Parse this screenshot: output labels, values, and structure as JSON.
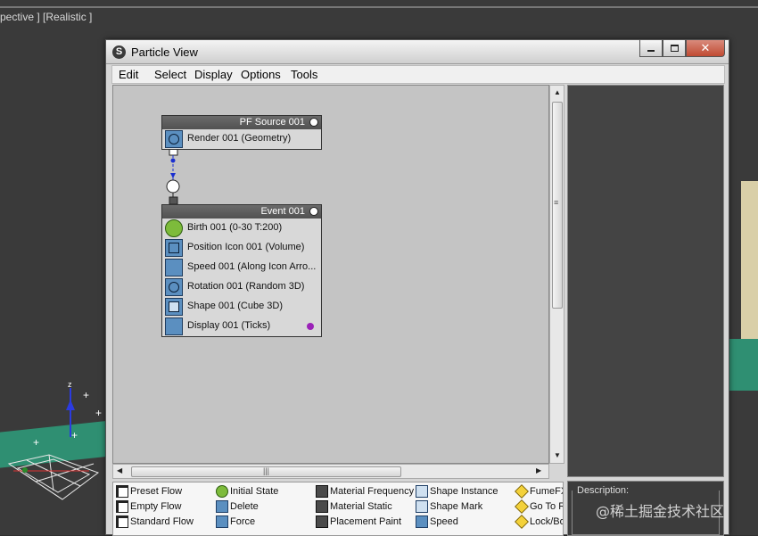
{
  "viewport": {
    "label": "pective ] [Realistic ]"
  },
  "window": {
    "title": "Particle View",
    "logo": "S",
    "close_glyph": "✕"
  },
  "menu": [
    "Edit",
    "Select",
    "Display",
    "Options",
    "Tools"
  ],
  "nodes": {
    "source": {
      "title": "PF Source 001",
      "operators": [
        "Render 001 (Geometry)"
      ]
    },
    "event": {
      "title": "Event 001",
      "operators": [
        "Birth 001 (0-30 T:200)",
        "Position Icon 001 (Volume)",
        "Speed 001 (Along Icon Arro...",
        "Rotation 001 (Random 3D)",
        "Shape 001 (Cube 3D)",
        "Display 001 (Ticks)"
      ]
    }
  },
  "description": {
    "label": "Description:"
  },
  "depot": {
    "col1": [
      "Preset Flow",
      "Empty Flow",
      "Standard Flow"
    ],
    "col2": [
      "Initial State",
      "Delete",
      "Force"
    ],
    "col3": [
      "Material Frequency",
      "Material Static",
      "Placement Paint"
    ],
    "col4": [
      "Shape Instance",
      "Shape Mark",
      "Speed"
    ],
    "col5": [
      "FumeFX",
      "Go To R",
      "Lock/Bo"
    ]
  },
  "watermark": "@稀土掘金技术社区",
  "colors": {
    "node_header": "#5e5e5e",
    "graph_bg": "#c4c4c4",
    "wire_blue": "#1a2fd0",
    "display_dot": "#9b22b8"
  }
}
